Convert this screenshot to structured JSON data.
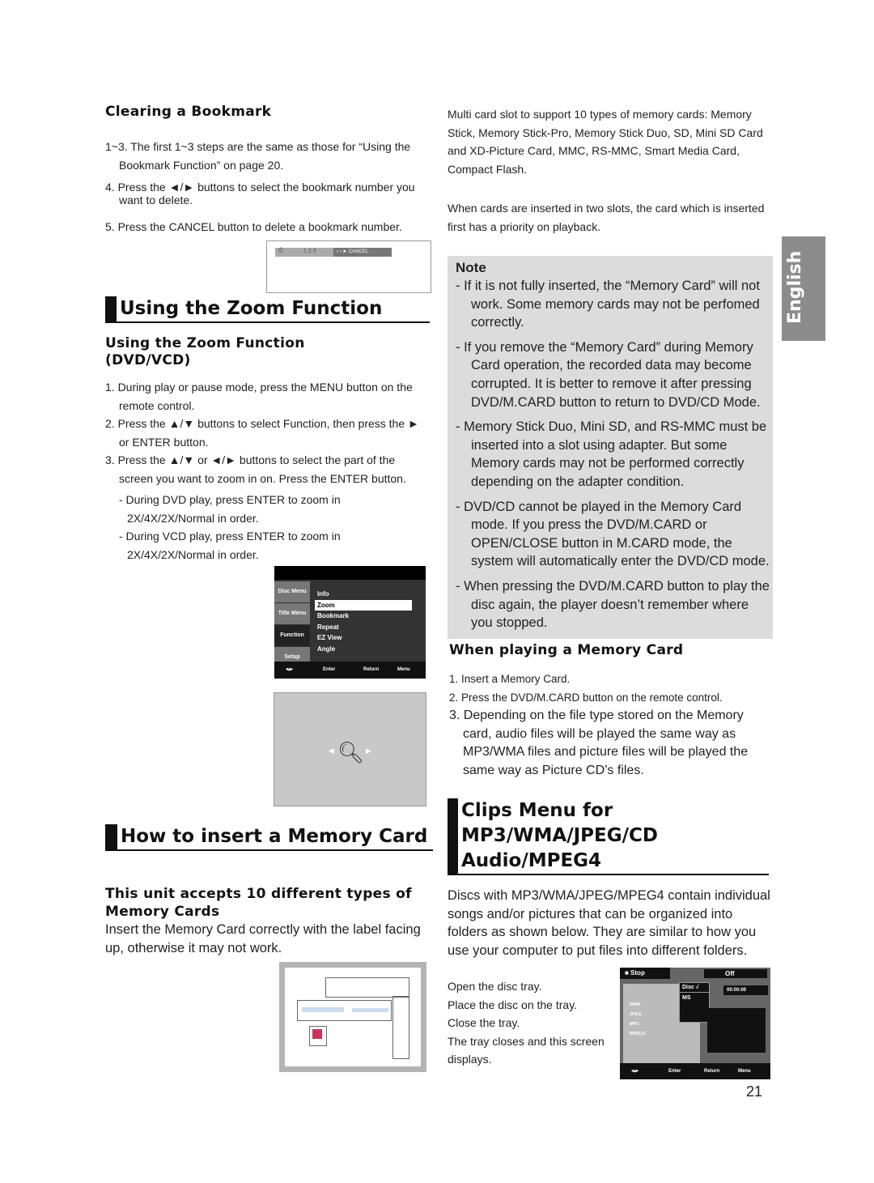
{
  "clearing": {
    "title": "Clearing a Bookmark",
    "steps": [
      "1~3. The first 1~3 steps are the same as those for  “Using the Bookmark Function” on page 20.",
      "4. Press the ◄/► buttons to select the bookmark number you want to delete.",
      "5. Press the CANCEL button to delete a bookmark number."
    ],
    "screen": {
      "numbers": "1  2  3",
      "cancel": "CANCEL"
    }
  },
  "zoom": {
    "title": "Using the Zoom Function",
    "subtitle": "Using the Zoom Function (DVD/VCD)",
    "steps": [
      "1. During play or pause mode, press the MENU button on the remote control.",
      "2. Press the ▲/▼ buttons to select Function, then press the ► or ENTER  button.",
      "3. Press the ▲/▼ or ◄/► buttons to select the part of the screen you want to zoom in on. Press the ENTER button."
    ],
    "subs": [
      "- During DVD play, press ENTER to zoom in 2X/4X/2X/Normal in order.",
      "- During VCD play, press ENTER to zoom in 2X/4X/2X/Normal in order."
    ],
    "menu": {
      "side": [
        "Disc Menu",
        "Title Menu",
        "Function",
        "Setup"
      ],
      "items": [
        "Info",
        "Zoom",
        "Bookmark",
        "Repeat",
        "EZ View",
        "Angle"
      ],
      "selected": 1,
      "footer": [
        "Enter",
        "Return",
        "Menu"
      ]
    }
  },
  "insert": {
    "title": "How to insert a Memory Card",
    "subtitle": "This unit accepts 10 different types of Memory Cards",
    "text": "Insert the Memory Card correctly with the label facing up, otherwise it may not work."
  },
  "right_top": {
    "p1": "Multi card slot to support 10 types of memory cards: Memory Stick, Memory Stick-Pro, Memory Stick Duo, SD, Mini SD Card and XD-Picture Card, MMC, RS-MMC, Smart Media Card, Compact Flash.",
    "p2": "When cards are inserted in two slots, the card which is inserted first has a priority on playback."
  },
  "note": {
    "title": "Note",
    "items": [
      "- If it is not fully inserted, the “Memory Card” will not work. Some memory cards may not be perfomed correctly.",
      "- If you remove the “Memory Card” during Memory Card operation, the recorded data may become corrupted. It is better to remove it after pressing DVD/M.CARD button to return to DVD/CD Mode.",
      "- Memory Stick Duo, Mini SD, and RS-MMC must be inserted into a slot using adapter. But some Memory cards may not be performed correctly depending on the adapter condition.",
      "- DVD/CD cannot be played in the Memory Card mode. If you press the DVD/M.CARD or OPEN/CLOSE button in M.CARD mode, the system will automatically enter the DVD/CD mode.",
      "- When pressing the DVD/M.CARD button to play the disc again, the player doesn’t remember where you stopped."
    ]
  },
  "playing": {
    "title": "When playing a Memory Card",
    "steps": [
      "1. Insert a Memory Card.",
      "2. Press the DVD/M.CARD button on the remote control.",
      "3. Depending on the file type stored on the Memory card, audio files will be played the same way as MP3/WMA files and picture files will be played the same way as Picture CD’s files."
    ]
  },
  "clips": {
    "title": "Clips Menu for MP3/WMA/JPEG/CD Audio/MPEG4",
    "text": "Discs with MP3/WMA/JPEG/MPEG4 contain individual songs and/or pictures that can be organized into folders as shown below. They are similar to how you use your computer to put files into different folders.",
    "steps": [
      "Open the disc tray.",
      "Place the disc on the tray.",
      "Close the tray.",
      "The tray closes and this screen displays."
    ],
    "screen": {
      "status": "■ Stop",
      "repeat": "Off",
      "disc": "Disc  √",
      "ms": "MS",
      "time": "00:00:00",
      "folders": [
        "WMA",
        "JPEG",
        "MP3",
        "MPEG4"
      ],
      "footer": [
        "Enter",
        "Return",
        "Menu"
      ]
    }
  },
  "tab": "English",
  "page_number": "21"
}
